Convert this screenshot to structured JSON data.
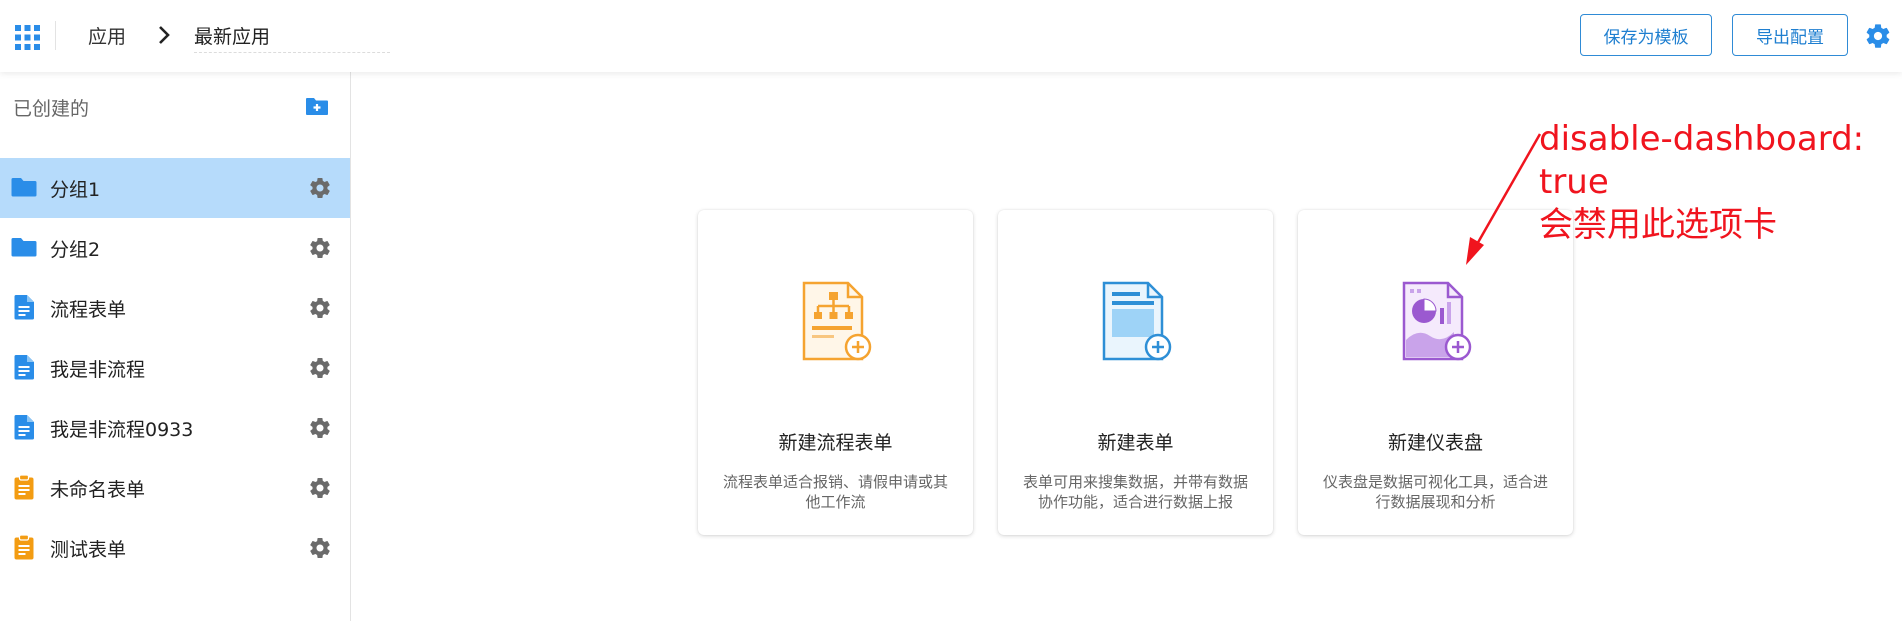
{
  "header": {
    "breadcrumb_root": "应用",
    "app_name": "最新应用",
    "save_template_label": "保存为模板",
    "export_config_label": "导出配置"
  },
  "sidebar": {
    "title": "已创建的",
    "items": [
      {
        "label": "分组1",
        "type": "folder",
        "active": true
      },
      {
        "label": "分组2",
        "type": "folder",
        "active": false
      },
      {
        "label": "流程表单",
        "type": "doc-blue",
        "active": false
      },
      {
        "label": "我是非流程",
        "type": "doc-blue",
        "active": false
      },
      {
        "label": "我是非流程0933",
        "type": "doc-blue",
        "active": false
      },
      {
        "label": "未命名表单",
        "type": "clipboard-orange",
        "active": false
      },
      {
        "label": "测试表单",
        "type": "clipboard-orange",
        "active": false
      }
    ]
  },
  "cards": [
    {
      "title": "新建流程表单",
      "desc": "流程表单适合报销、请假申请或其他工作流",
      "icon": "flowchart-doc-icon"
    },
    {
      "title": "新建表单",
      "desc": "表单可用来搜集数据，并带有数据协作功能，适合进行数据上报",
      "icon": "form-doc-icon"
    },
    {
      "title": "新建仪表盘",
      "desc": "仪表盘是数据可视化工具，适合进行数据展现和分析",
      "icon": "dashboard-doc-icon"
    }
  ],
  "annotation": {
    "line1": "disable-dashboard:",
    "line2": "true",
    "line3": "会禁用此选项卡"
  },
  "colors": {
    "accent": "#2f8bd6",
    "folder_blue": "#2a8de8",
    "orange": "#f39c12",
    "purple": "#9b59d0",
    "annotation_red": "#f0141e",
    "active_row": "#b6dbfb"
  }
}
